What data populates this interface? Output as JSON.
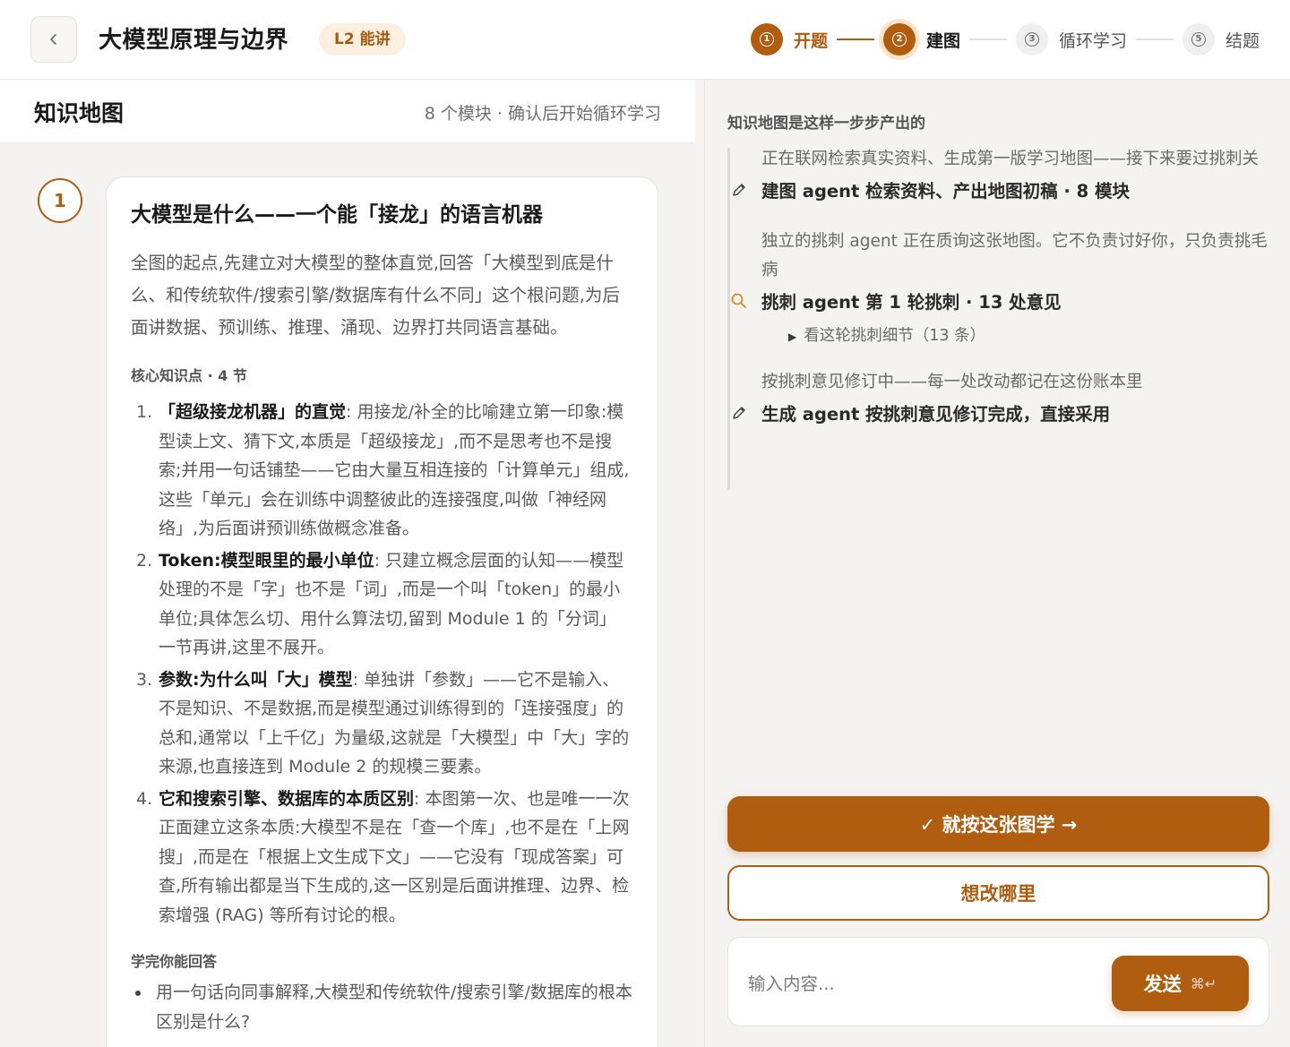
{
  "header": {
    "back_icon": "chevron-left-icon",
    "course_title": "大模型原理与边界",
    "level_badge": "L2 能讲",
    "steps": [
      {
        "num": "1",
        "label": "开题",
        "state": "done"
      },
      {
        "num": "2",
        "label": "建图",
        "state": "current"
      },
      {
        "num": "3",
        "label": "循环学习",
        "state": "todo"
      },
      {
        "num": "5",
        "label": "结题",
        "state": "todo"
      }
    ]
  },
  "map": {
    "title": "知识地图",
    "subtitle": "8 个模块 · 确认后开始循环学习",
    "module": {
      "number": "1",
      "title": "大模型是什么——一个能「接龙」的语言机器",
      "description": "全图的起点,先建立对大模型的整体直觉,回答「大模型到底是什么、和传统软件/搜索引擎/数据库有什么不同」这个根问题,为后面讲数据、预训练、推理、涌现、边界打共同语言基础。",
      "points_label": "核心知识点 · 4 节",
      "points": [
        {
          "num": "1.",
          "title": "「超级接龙机器」的直觉",
          "body": "用接龙/补全的比喻建立第一印象:模型读上文、猜下文,本质是「超级接龙」,而不是思考也不是搜索;并用一句话铺垫——它由大量互相连接的「计算单元」组成,这些「单元」会在训练中调整彼此的连接强度,叫做「神经网络」,为后面讲预训练做概念准备。"
        },
        {
          "num": "2.",
          "title": "Token:模型眼里的最小单位",
          "body": "只建立概念层面的认知——模型处理的不是「字」也不是「词」,而是一个叫「token」的最小单位;具体怎么切、用什么算法切,留到 Module 1 的「分词」一节再讲,这里不展开。"
        },
        {
          "num": "3.",
          "title": "参数:为什么叫「大」模型",
          "body": "单独讲「参数」——它不是输入、不是知识、不是数据,而是模型通过训练得到的「连接强度」的总和,通常以「上千亿」为量级,这就是「大模型」中「大」字的来源,也直接连到 Module 2 的规模三要素。"
        },
        {
          "num": "4.",
          "title": "它和搜索引擎、数据库的本质区别",
          "body": "本图第一次、也是唯一一次正面建立这条本质:大模型不是在「查一个库」,也不是在「上网搜」,而是在「根据上文生成下文」——它没有「现成答案」可查,所有输出都是当下生成的,这一区别是后面讲推理、边界、检索增强 (RAG) 等所有讨论的根。"
        }
      ],
      "outcomes_label": "学完你能回答",
      "outcomes": [
        "用一句话向同事解释,大模型和传统软件/搜索引擎/数据库的根本区别是什么?"
      ]
    }
  },
  "process": {
    "heading": "知识地图是这样一步步产出的",
    "entries": [
      {
        "note": "正在联网检索真实资料、生成第一版学习地图——接下来要过挑刺关",
        "icon": "pencil-icon",
        "event": "建图 agent 检索资料、产出地图初稿 · 8 模块"
      },
      {
        "note": "独立的挑刺 agent 正在质询这张地图。它不负责讨好你，只负责挑毛病",
        "icon": "search-icon",
        "event": "挑刺 agent 第 1 轮挑刺 · 13 处意见",
        "toggle": "看这轮挑刺细节（13 条）"
      },
      {
        "note": "按挑刺意见修订中——每一处改动都记在这份账本里",
        "icon": "pencil-icon",
        "event": "生成 agent 按挑刺意见修订完成，直接采用"
      }
    ]
  },
  "actions": {
    "confirm_label": "✓ 就按这张图学 →",
    "edit_label": "想改哪里",
    "input_placeholder": "输入内容...",
    "send_label": "发送",
    "send_hint": "⌘↵"
  },
  "colors": {
    "accent": "#b05d10",
    "accent_soft": "#fcefdf",
    "panel_bg": "#f4f3f1"
  }
}
